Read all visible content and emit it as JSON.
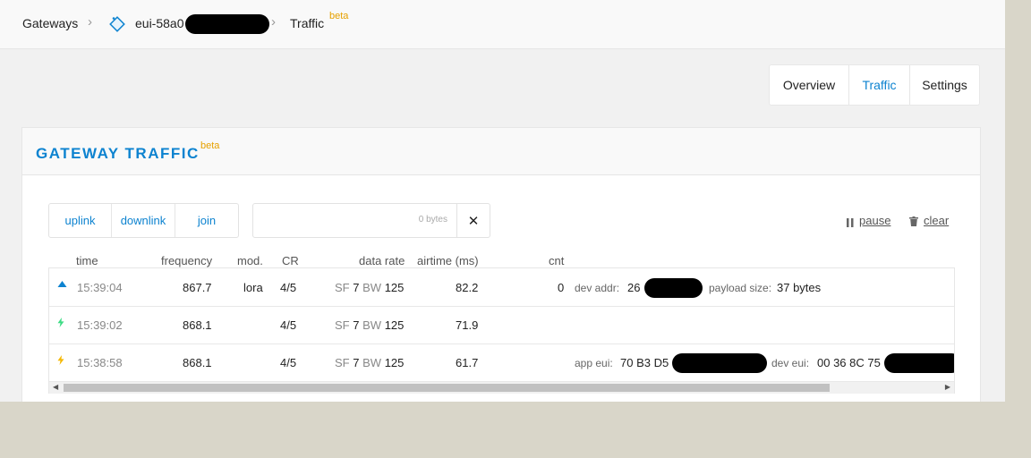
{
  "breadcrumb": {
    "gateways": "Gateways",
    "gateway_id": "eui-58a0",
    "traffic": "Traffic",
    "beta": "beta"
  },
  "tabs": [
    {
      "label": "Overview",
      "active": false
    },
    {
      "label": "Traffic",
      "active": true
    },
    {
      "label": "Settings",
      "active": false
    }
  ],
  "panel": {
    "title": "GATEWAY TRAFFIC",
    "beta": "beta"
  },
  "filters": [
    "uplink",
    "downlink",
    "join"
  ],
  "search": {
    "value": "",
    "bytes": "0 bytes",
    "clear_icon": "close-icon"
  },
  "actions": {
    "pause": "pause",
    "clear": "clear"
  },
  "columns": [
    "time",
    "frequency",
    "mod.",
    "CR",
    "data rate",
    "airtime (ms)",
    "cnt"
  ],
  "rows": [
    {
      "icon": "uplink-arrow-icon",
      "time": "15:39:04",
      "frequency": "867.7",
      "mod": "lora",
      "cr": "4/5",
      "sf_label": "SF",
      "sf": "7",
      "bw_label": "BW",
      "bw": "125",
      "airtime": "82.2",
      "cnt": "0",
      "k1": "dev addr:",
      "v1": "26",
      "k2": "payload size:",
      "v2": "37 bytes"
    },
    {
      "icon": "downlink-bolt-icon",
      "time": "15:39:02",
      "frequency": "868.1",
      "mod": "",
      "cr": "4/5",
      "sf_label": "SF",
      "sf": "7",
      "bw_label": "BW",
      "bw": "125",
      "airtime": "71.9",
      "cnt": ""
    },
    {
      "icon": "join-bolt-icon",
      "time": "15:38:58",
      "frequency": "868.1",
      "mod": "",
      "cr": "4/5",
      "sf_label": "SF",
      "sf": "7",
      "bw_label": "BW",
      "bw": "125",
      "airtime": "61.7",
      "cnt": "",
      "k1": "app eui:",
      "v1": "70 B3 D5",
      "k2": "dev eui:",
      "v2": "00 36 8C 75"
    }
  ],
  "colors": {
    "accent": "#0d83d0",
    "beta": "#e6a100",
    "uplink": "#0d83d0",
    "downlink": "#3ddc84",
    "join": "#f5b800"
  }
}
